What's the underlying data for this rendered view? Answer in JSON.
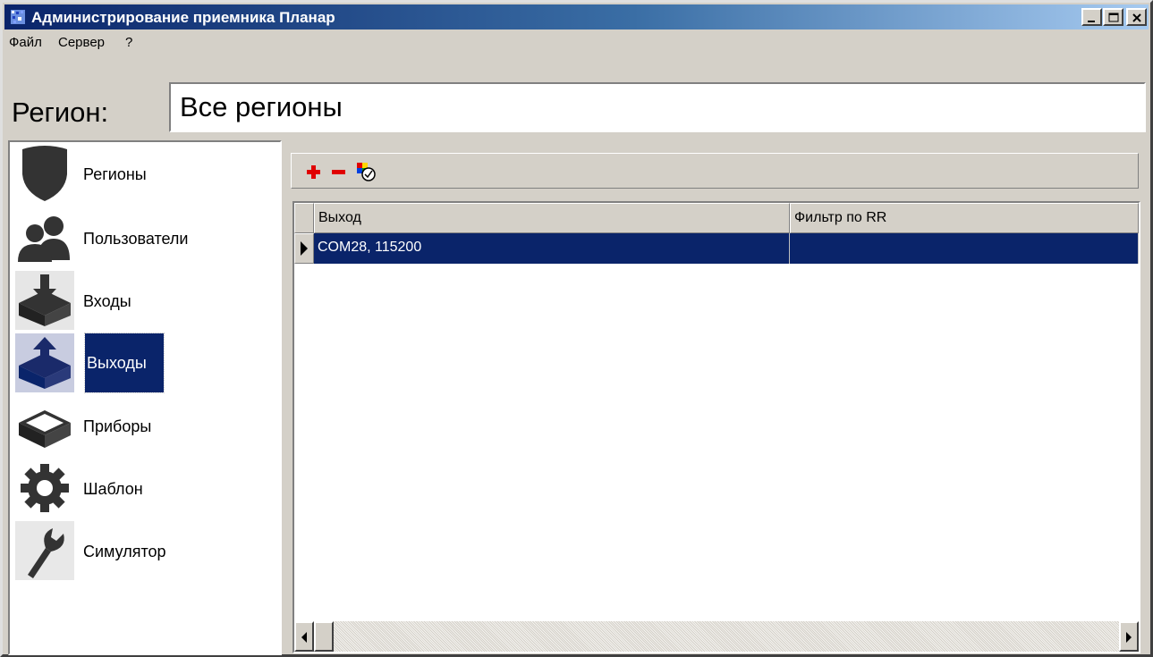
{
  "window": {
    "title": "Администрирование приемника Планар",
    "titlebar_gradient": [
      "#0a246a",
      "#a6caf0"
    ],
    "controls": [
      "minimize-icon",
      "maximize-icon",
      "close-icon"
    ]
  },
  "menu": {
    "items": [
      {
        "label": "Файл"
      },
      {
        "label": "Сервер"
      },
      {
        "label": "?"
      }
    ]
  },
  "region": {
    "label": "Регион:",
    "value": "Все регионы"
  },
  "nav": {
    "items": [
      {
        "label": "Регионы",
        "icon": "shield-icon"
      },
      {
        "label": "Пользователи",
        "icon": "users-icon"
      },
      {
        "label": "Входы",
        "icon": "inbox-download-icon"
      },
      {
        "label": "Выходы",
        "icon": "outbox-upload-icon",
        "selected": true
      },
      {
        "label": "Приборы",
        "icon": "device-box-icon"
      },
      {
        "label": "Шаблон",
        "icon": "gear-icon"
      },
      {
        "label": "Симулятор",
        "icon": "wrench-icon"
      }
    ],
    "selection_color": "#0a246a"
  },
  "toolbar": {
    "buttons": [
      {
        "icon": "add-plus-icon",
        "color": "#e00000"
      },
      {
        "icon": "remove-minus-icon",
        "color": "#e00000"
      },
      {
        "icon": "edit-properties-icon"
      }
    ]
  },
  "grid": {
    "columns": [
      "Выход",
      "Фильтр по RR"
    ],
    "rows": [
      {
        "values": [
          "COM28, 115200",
          ""
        ],
        "selected": true
      }
    ],
    "selection_color": "#0a246a"
  }
}
